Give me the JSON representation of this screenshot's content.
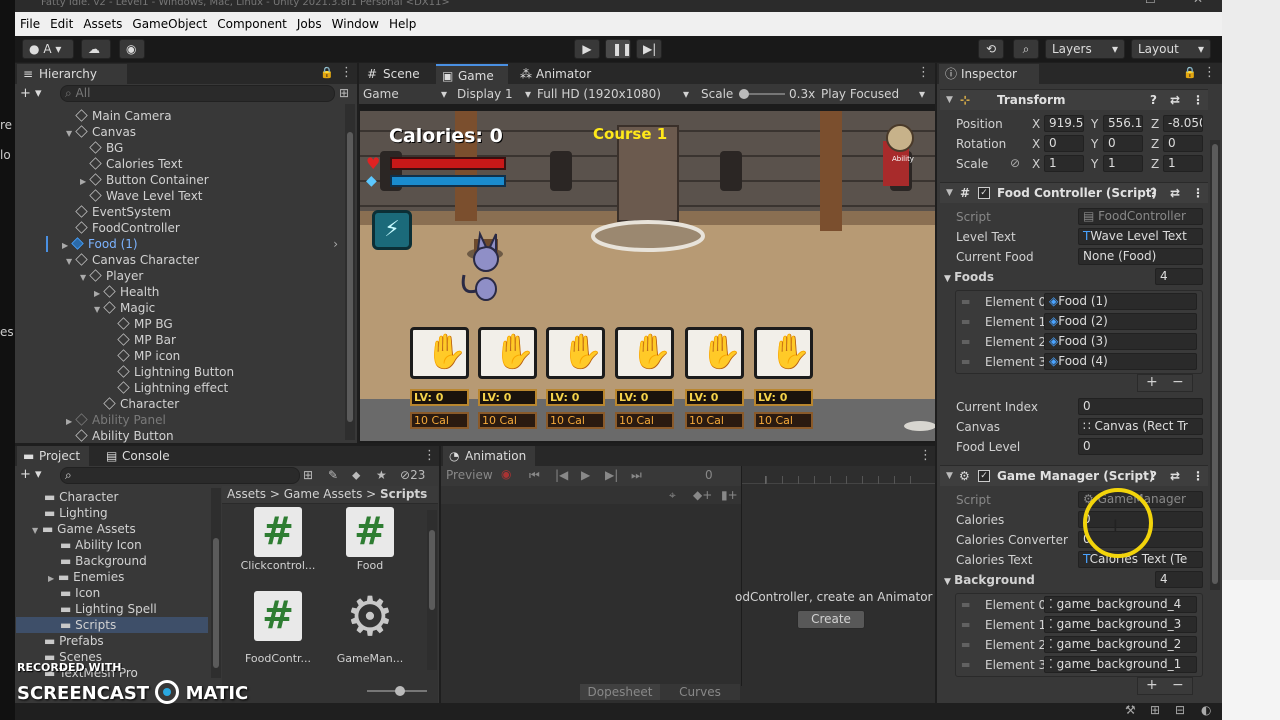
{
  "title_bar": {
    "text": "Fatty Idle. v2 - Level1 - Windows, Mac, Linux - Unity 2021.3.8f1 Personal <DX11>"
  },
  "menu": [
    "File",
    "Edit",
    "Assets",
    "GameObject",
    "Component",
    "Jobs",
    "Window",
    "Help"
  ],
  "toolbar": {
    "account": "A",
    "layers": "Layers",
    "layout": "Layout"
  },
  "hierarchy": {
    "tab": "Hierarchy",
    "search_placeholder": "All",
    "items": [
      {
        "label": "Main Camera"
      },
      {
        "label": "Canvas"
      },
      {
        "label": "BG"
      },
      {
        "label": "Calories Text"
      },
      {
        "label": "Button Container"
      },
      {
        "label": "Wave Level Text"
      },
      {
        "label": "EventSystem"
      },
      {
        "label": "FoodController"
      },
      {
        "label": "Food (1)"
      },
      {
        "label": "Canvas Character"
      },
      {
        "label": "Player"
      },
      {
        "label": "Health"
      },
      {
        "label": "Magic"
      },
      {
        "label": "MP BG"
      },
      {
        "label": "MP Bar"
      },
      {
        "label": "MP icon"
      },
      {
        "label": "Lightning Button"
      },
      {
        "label": "Lightning effect"
      },
      {
        "label": "Character"
      },
      {
        "label": "Ability Panel"
      },
      {
        "label": "Ability Button"
      }
    ]
  },
  "scene_tabs": {
    "scene": "Scene",
    "game": "Game",
    "animator": "Animator"
  },
  "game_toolbar": {
    "mode": "Game",
    "display": "Display 1",
    "resolution": "Full HD (1920x1080)",
    "scale_label": "Scale",
    "scale_value": "0.3x",
    "play_focused": "Play Focused"
  },
  "game_view": {
    "calories": "Calories: 0",
    "course": "Course 1",
    "sign": "Ability",
    "slots": [
      {
        "lv": "LV: 0",
        "cal": "10 Cal"
      },
      {
        "lv": "LV: 0",
        "cal": "10 Cal"
      },
      {
        "lv": "LV: 0",
        "cal": "10 Cal"
      },
      {
        "lv": "LV: 0",
        "cal": "10 Cal"
      },
      {
        "lv": "LV: 0",
        "cal": "10 Cal"
      },
      {
        "lv": "LV: 0",
        "cal": "10 Cal"
      }
    ]
  },
  "project": {
    "tab": "Project",
    "console_tab": "Console",
    "hidden_count": "23",
    "folders": [
      "Character",
      "Lighting",
      "Game Assets",
      "Ability Icon",
      "Background",
      "Enemies",
      "Icon",
      "Lighting Spell",
      "Scripts",
      "Prefabs",
      "Scenes",
      "TextMesh Pro"
    ],
    "breadcrumb": [
      "Assets",
      "Game Assets",
      "Scripts"
    ],
    "files": [
      "Clickcontrol...",
      "Food",
      "FoodContr...",
      "GameMan..."
    ]
  },
  "animation": {
    "tab": "Animation",
    "preview": "Preview",
    "frame": "0",
    "message": "odController, create an Animator",
    "create": "Create",
    "dopesheet": "Dopesheet",
    "curves": "Curves"
  },
  "inspector": {
    "tab": "Inspector",
    "transform": {
      "title": "Transform",
      "position_label": "Position",
      "rotation_label": "Rotation",
      "scale_label": "Scale",
      "pos": [
        "919.53",
        "556.10",
        "-8.050"
      ],
      "rot": [
        "0",
        "0",
        "0"
      ],
      "scale": [
        "1",
        "1",
        "1"
      ]
    },
    "food_controller": {
      "title": "Food Controller (Script)",
      "script_label": "Script",
      "script": "FoodController",
      "level_text_label": "Level Text",
      "level_text": "Wave Level Text",
      "current_food_label": "Current Food",
      "current_food": "None (Food)",
      "foods_label": "Foods",
      "foods_count": "4",
      "elements": [
        {
          "label": "Element 0",
          "value": "Food (1)"
        },
        {
          "label": "Element 1",
          "value": "Food (2)"
        },
        {
          "label": "Element 2",
          "value": "Food (3)"
        },
        {
          "label": "Element 3",
          "value": "Food (4)"
        }
      ],
      "current_index_label": "Current Index",
      "current_index": "0",
      "canvas_label": "Canvas",
      "canvas": "Canvas (Rect Tr",
      "food_level_label": "Food Level",
      "food_level": "0"
    },
    "game_manager": {
      "title": "Game Manager (Script)",
      "script_label": "Script",
      "script": "GameManager",
      "calories_label": "Calories",
      "calories": "0",
      "converter_label": "Calories Converter",
      "converter": "0",
      "calories_text_label": "Calories Text",
      "calories_text": "Calories Text (Te",
      "background_label": "Background",
      "background_count": "4",
      "elements": [
        {
          "label": "Element 0",
          "value": "game_background_4"
        },
        {
          "label": "Element 1",
          "value": "game_background_3"
        },
        {
          "label": "Element 2",
          "value": "game_background_2"
        },
        {
          "label": "Element 3",
          "value": "game_background_1"
        }
      ]
    }
  },
  "watermark": {
    "recorded": "RECORDED WITH",
    "brand": "SCREENCAST",
    "brand2": "MATIC"
  }
}
